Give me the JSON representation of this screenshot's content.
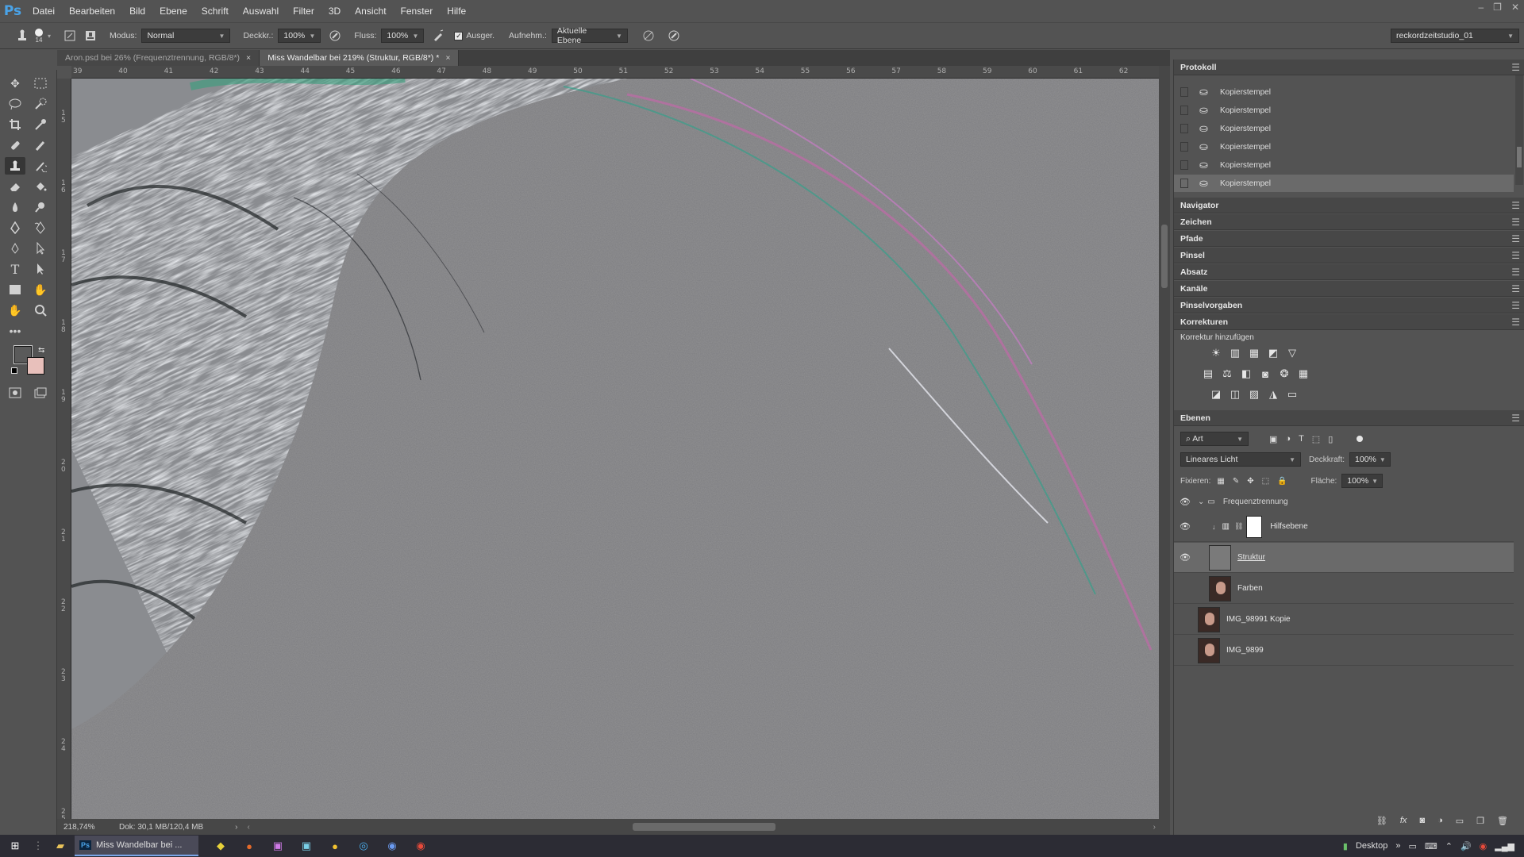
{
  "app": {
    "logo": "Ps",
    "menus": [
      "Datei",
      "Bearbeiten",
      "Bild",
      "Ebene",
      "Schrift",
      "Auswahl",
      "Filter",
      "3D",
      "Ansicht",
      "Fenster",
      "Hilfe"
    ],
    "window_controls": [
      "–",
      "❐",
      "✕"
    ]
  },
  "options": {
    "brush_size": "14",
    "modus_label": "Modus:",
    "modus_value": "Normal",
    "deckkraft_label": "Deckkr.:",
    "deckkraft_value": "100%",
    "fluss_label": "Fluss:",
    "fluss_value": "100%",
    "ausger_label": "Ausger.",
    "aufnehm_label": "Aufnehm.:",
    "aufnehm_value": "Aktuelle Ebene",
    "workspace": "reckordzeitstudio_01"
  },
  "tabs": [
    {
      "label": "Aron.psd bei 26% (Frequenztrennung, RGB/8*)",
      "active": false
    },
    {
      "label": "Miss Wandelbar bei 219% (Struktur, RGB/8*) *",
      "active": true
    }
  ],
  "ruler_top": [
    "39",
    "40",
    "41",
    "42",
    "43",
    "44",
    "45",
    "46",
    "47",
    "48",
    "49",
    "50",
    "51",
    "52",
    "53",
    "54",
    "55",
    "56",
    "57",
    "58",
    "59",
    "60",
    "61",
    "62"
  ],
  "ruler_left": [
    "1\n5",
    "1\n6",
    "1\n7",
    "1\n8",
    "1\n9",
    "2\n0",
    "2\n1",
    "2\n2",
    "2\n3",
    "2\n4",
    "2\n5"
  ],
  "status": {
    "zoom": "218,74%",
    "doc": "Dok: 30,1 MB/120,4 MB"
  },
  "history": {
    "title": "Protokoll",
    "items": [
      "Kopierstempel",
      "Kopierstempel",
      "Kopierstempel",
      "Kopierstempel",
      "Kopierstempel",
      "Kopierstempel"
    ]
  },
  "collapsed_panels": [
    "Navigator",
    "Zeichen",
    "Pfade",
    "Pinsel",
    "Absatz",
    "Kanäle",
    "Pinselvorgaben"
  ],
  "corrections": {
    "title": "Korrekturen",
    "subtitle": "Korrektur hinzufügen"
  },
  "layers": {
    "title": "Ebenen",
    "filter_kind": "Art",
    "blend_mode": "Lineares Licht",
    "opacity_label": "Deckkraft:",
    "opacity_value": "100%",
    "lock_label": "Fixieren:",
    "fill_label": "Fläche:",
    "fill_value": "100%",
    "items": [
      {
        "name": "Frequenztrennung",
        "type": "group",
        "visible": true
      },
      {
        "name": "Hilfsebene",
        "type": "adjustment",
        "visible": true
      },
      {
        "name": "Struktur",
        "type": "pixel",
        "visible": true,
        "selected": true
      },
      {
        "name": "Farben",
        "type": "pixel",
        "visible": false
      },
      {
        "name": "IMG_98991 Kopie",
        "type": "pixel",
        "visible": false
      },
      {
        "name": "IMG_9899",
        "type": "pixel",
        "visible": false
      }
    ]
  },
  "taskbar": {
    "active_window": "Miss Wandelbar bei ...",
    "desktop_label": "Desktop"
  }
}
